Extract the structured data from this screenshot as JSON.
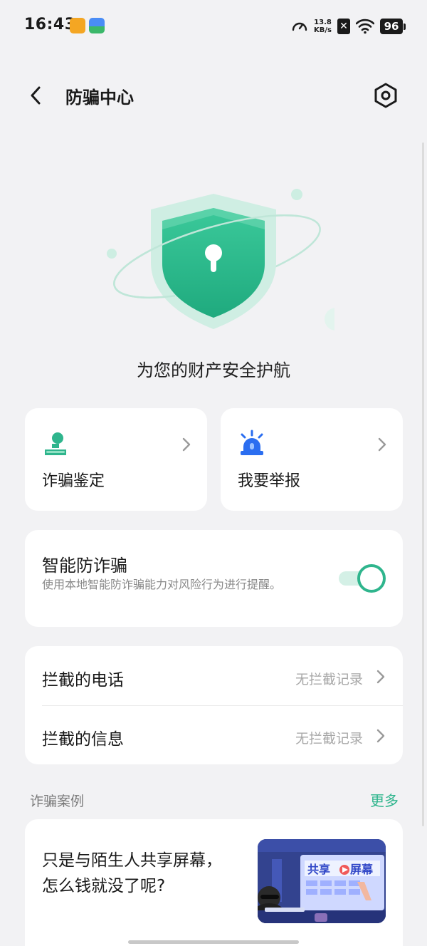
{
  "status_bar": {
    "time": "16:43",
    "speed_value": "13.8",
    "speed_unit": "KB/s",
    "battery": "96"
  },
  "header": {
    "title": "防骗中心"
  },
  "hero": {
    "tagline": "为您的财产安全护航"
  },
  "features": [
    {
      "label": "诈骗鉴定",
      "icon": "user-check-icon"
    },
    {
      "label": "我要举报",
      "icon": "alarm-siren-icon"
    }
  ],
  "smart_protection": {
    "title": "智能防诈骗",
    "description": "使用本地智能防诈骗能力对风险行为进行提醒。",
    "enabled": true
  },
  "intercepts": [
    {
      "label": "拦截的电话",
      "value": "无拦截记录"
    },
    {
      "label": "拦截的信息",
      "value": "无拦截记录"
    }
  ],
  "cases_section": {
    "title": "诈骗案例",
    "more": "更多"
  },
  "case": {
    "title": "只是与陌生人共享屏幕，怎么钱就没了呢?",
    "thumbnail_text": "共享 屏幕"
  },
  "colors": {
    "accent": "#2fb58d",
    "alert_blue": "#2b6ef0",
    "background": "#f2f2f4"
  }
}
